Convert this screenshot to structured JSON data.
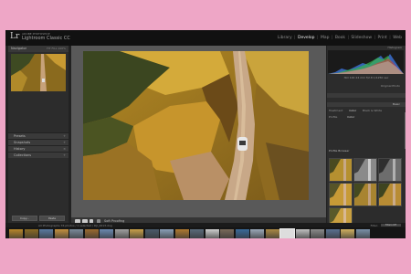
{
  "app": {
    "logo": "Lr",
    "brand_line1": "ADOBE PHOTOSHOP",
    "brand_line2": "Lightroom Classic CC"
  },
  "modules": [
    "Library",
    "Develop",
    "Map",
    "Book",
    "Slideshow",
    "Print",
    "Web"
  ],
  "active_module": "Develop",
  "left_panel": {
    "navigator_title": "Navigator",
    "navigator_options": "FIT  FILL  100%",
    "sections": [
      "Presets",
      "Snapshots",
      "History",
      "Collections"
    ],
    "copy_button": "Copy...",
    "paste_button": "Paste"
  },
  "toolbar": {
    "label": "Soft Proofing"
  },
  "right_panel": {
    "histogram_title": "Histogram",
    "photo_info": "ISO 100   24 mm   f/2.8   1/1250 sec",
    "original_photo": "Original Photo",
    "basic_title": "Basic",
    "treatment": "Treatment",
    "color_label": "Color",
    "bw_label": "Black & White",
    "profile_label": "Profile",
    "profile_value": "Color",
    "profile_browser_title": "Profile Browser"
  },
  "filmstrip": {
    "info": "All Photographs   76 photos / 1 selected / DJI_0013.dng",
    "filter_label": "Filter:",
    "filter_value": "Filters Off"
  },
  "colors": {
    "background": "#eea6c6",
    "app_bg": "#222222",
    "panel_bg": "#2c2c2c",
    "center_bg": "#595959"
  }
}
